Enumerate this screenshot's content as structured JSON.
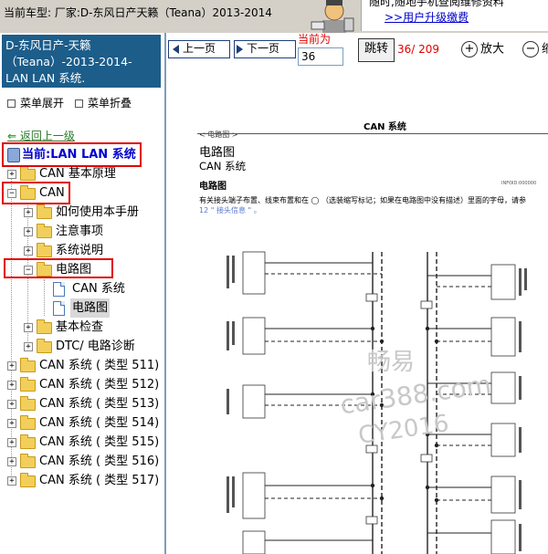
{
  "top": {
    "car_model": "当前车型: 厂家:D-东风日产天籁（Teana）2013-2014",
    "notice_text": "随时,随地手机查阅维修资料",
    "upgrade_link": ">>用户升级缴费"
  },
  "sidebar": {
    "title": "D-东风日产-天籁（Teana）-2013-2014- LAN LAN 系统.",
    "expand_label": "菜单展开",
    "collapse_label": "菜单折叠",
    "back_label": "返回上一级",
    "current_label": "当前:LAN LAN 系统",
    "tree": [
      {
        "label": "CAN 基本原理"
      },
      {
        "label": "CAN"
      },
      {
        "label": "如何使用本手册"
      },
      {
        "label": "注意事项"
      },
      {
        "label": "系统说明"
      },
      {
        "label": "电路图"
      },
      {
        "label": "CAN 系统"
      },
      {
        "label": "电路图"
      },
      {
        "label": "基本检查"
      },
      {
        "label": "DTC/ 电路诊断"
      },
      {
        "label": "CAN 系统 ( 类型 511)"
      },
      {
        "label": "CAN 系统 ( 类型 512)"
      },
      {
        "label": "CAN 系统 ( 类型 513)"
      },
      {
        "label": "CAN 系统 ( 类型 514)"
      },
      {
        "label": "CAN 系统 ( 类型 515)"
      },
      {
        "label": "CAN 系统 ( 类型 516)"
      },
      {
        "label": "CAN 系统 ( 类型 517)"
      }
    ]
  },
  "toolbar": {
    "prev_label": "上一页",
    "next_label": "下一页",
    "current_label": "当前为",
    "page_value": "36",
    "jump_label": "跳转",
    "page_count": "36/ 209",
    "zoom_in_label": "放大",
    "zoom_out_label": "缩"
  },
  "document": {
    "header": "CAN 系统",
    "section_tag": "< 电路图 >",
    "h1": "电路图",
    "h2": "CAN 系统",
    "h3": "电路图",
    "code": "INFOID:000000",
    "desc": "有关接头端子布置、线束布置和在 ◯ （选装缩写标记；如果在电路图中没有描述）里面的字母，请参",
    "link": "12 \" 接头信息 \" 。",
    "watermark_1": "畅易",
    "watermark_2": "car388.com",
    "watermark_3": "CY2016"
  },
  "colors": {
    "title_bg": "#1c5d8a",
    "highlight_red": "#e00000",
    "link_blue": "#0000cc"
  }
}
